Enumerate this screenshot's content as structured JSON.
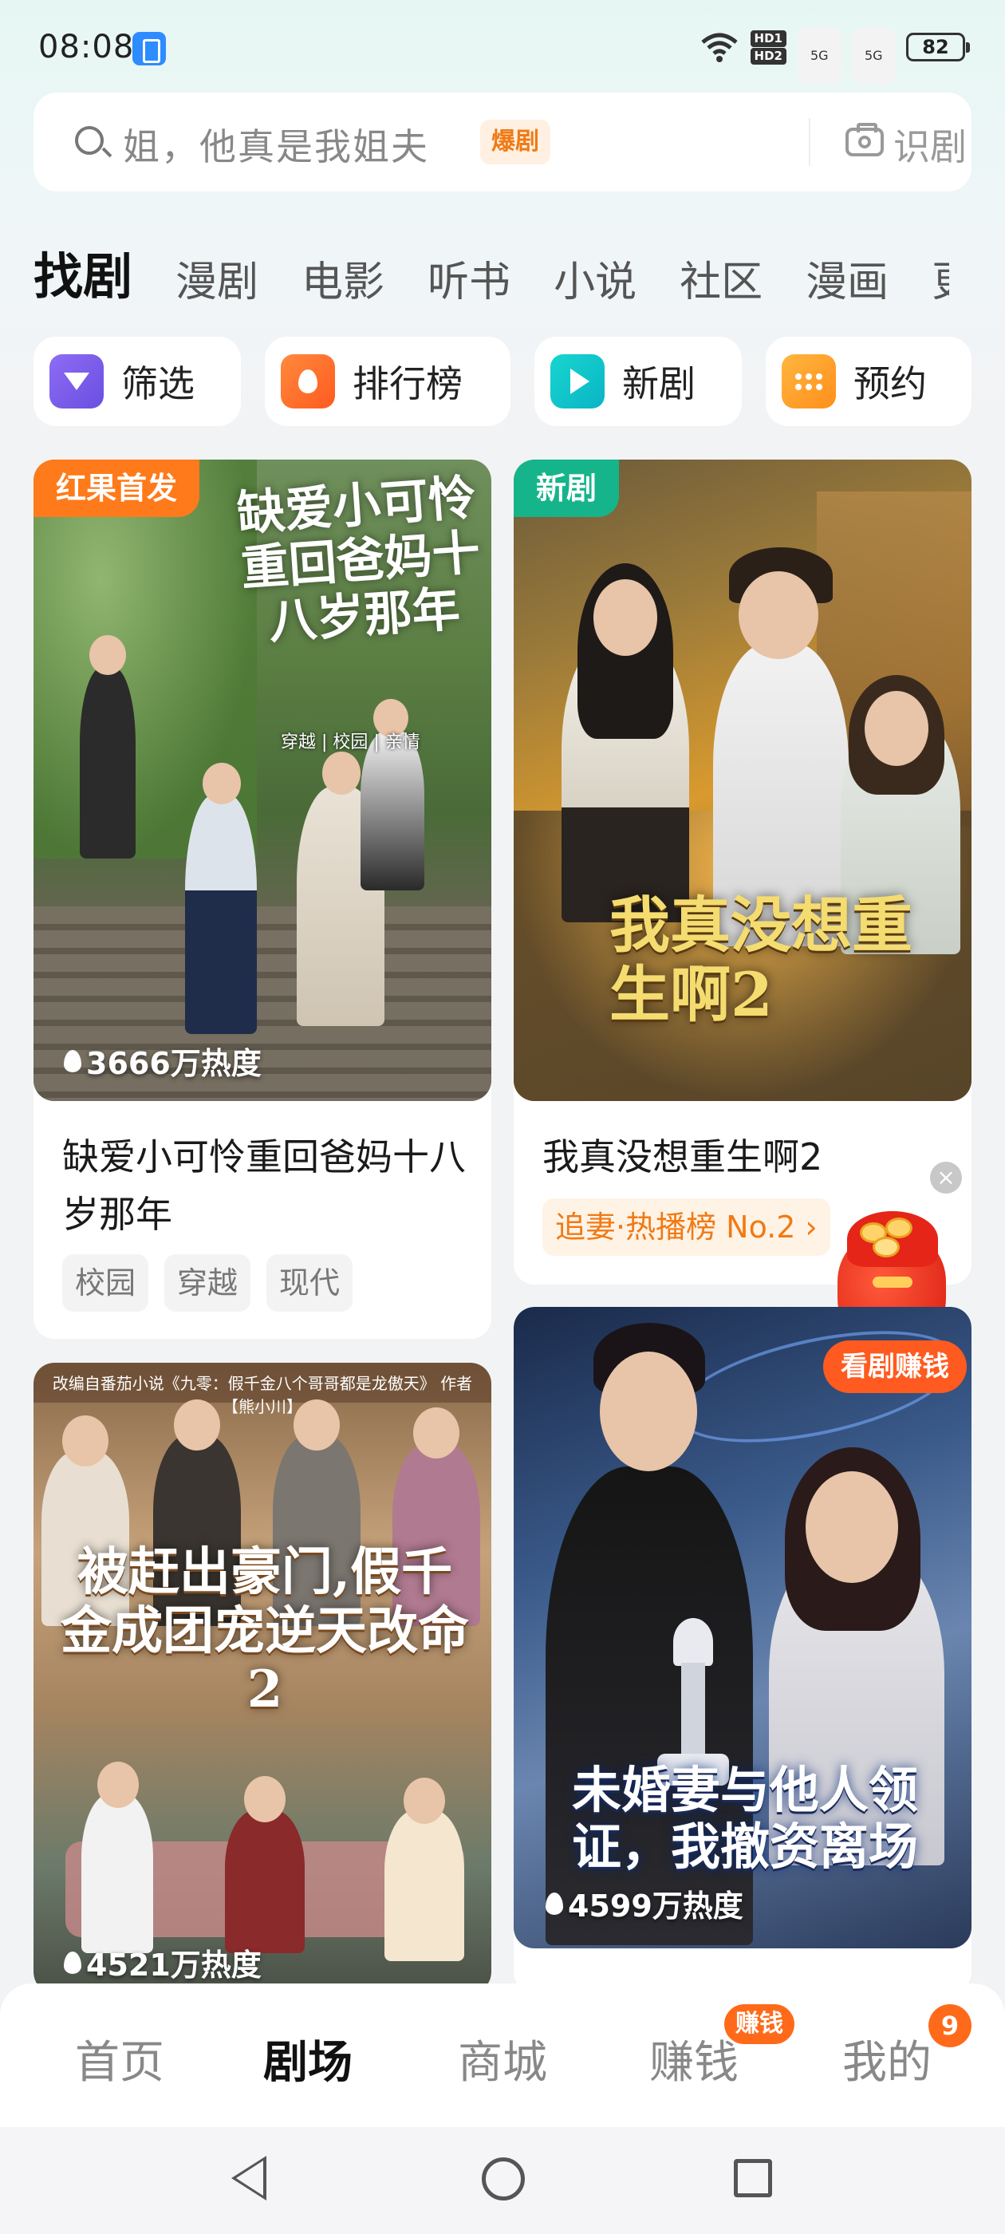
{
  "status_bar": {
    "time": "08:08",
    "network_labels": [
      "HD1",
      "HD2",
      "5G",
      "5G"
    ],
    "battery": "82"
  },
  "search": {
    "placeholder": "姐，他真是我姐夫",
    "badge": "爆剧",
    "recognize_label": "识剧"
  },
  "category_tabs": [
    "找剧",
    "漫剧",
    "电影",
    "听书",
    "小说",
    "社区",
    "漫画"
  ],
  "quick_buttons": [
    {
      "label": "筛选",
      "icon": "filter-icon"
    },
    {
      "label": "排行榜",
      "icon": "flame-icon"
    },
    {
      "label": "新剧",
      "icon": "play-icon"
    },
    {
      "label": "预约",
      "icon": "grid-dots-icon"
    }
  ],
  "cards": [
    {
      "badge": "红果首发",
      "poster_title": "缺爱小可怜重回爸妈十八岁那年",
      "poster_subtitle": "穿越 | 校园 | 亲情",
      "heat": "3666万热度",
      "title": "缺爱小可怜重回爸妈十八岁那年",
      "tags": [
        "校园",
        "穿越",
        "现代"
      ]
    },
    {
      "badge": "新剧",
      "poster_title": "我真没想重生啊2",
      "title": "我真没想重生啊2",
      "ranking": "追妻·热播榜 No.2"
    },
    {
      "poster_caption": "改编自番茄小说《九零：假千金八个哥哥都是龙傲天》 作者【熊小川】",
      "poster_title": "被赶出豪门,假千金成团宠逆天改命2",
      "heat": "4521万热度"
    },
    {
      "badge": "看剧赚钱",
      "poster_title": "未婚妻与他人领证，我撤资离场",
      "heat": "4599万热度"
    }
  ],
  "bottom_nav": {
    "items": [
      "首页",
      "剧场",
      "商城",
      "赚钱",
      "我的"
    ],
    "active": "剧场",
    "earn_badge": "赚钱",
    "mine_badge": "9"
  },
  "colors": {
    "accent_orange": "#ff6a1a",
    "new_badge_green": "#16b48a",
    "first_release_orange": "#ff7a1a"
  }
}
